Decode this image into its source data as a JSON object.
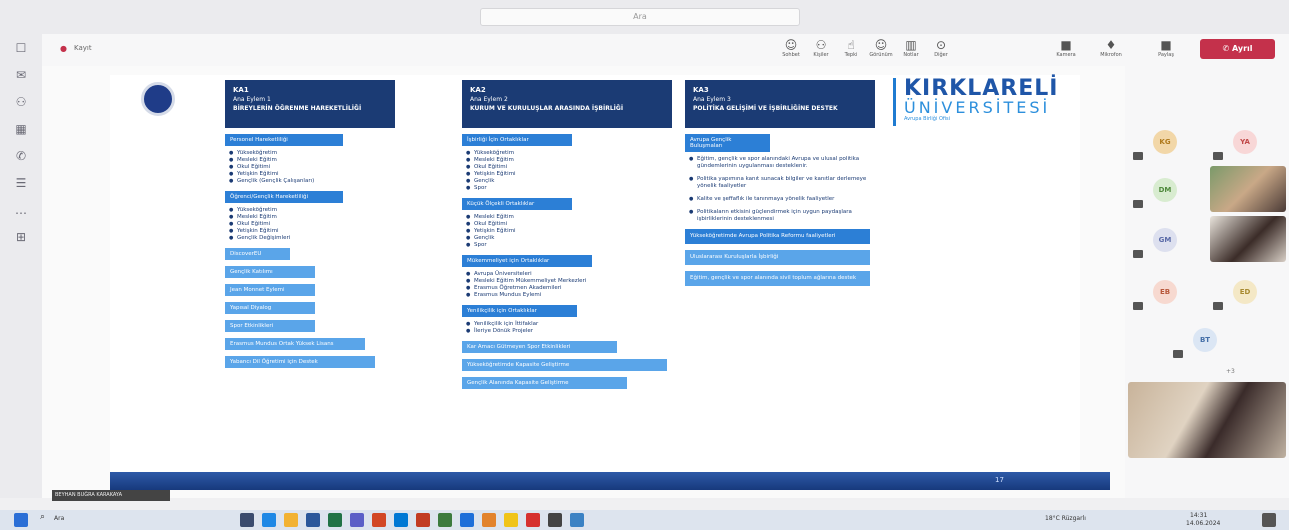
{
  "app": {
    "search_placeholder": "Ara"
  },
  "toolbar": {
    "items": [
      "Sohbet",
      "Kişiler",
      "Tepki",
      "Görünüm",
      "Notlar",
      "Diğer",
      "Kamera",
      "Mikrofon",
      "Paylaş"
    ],
    "leave_label": "Ayrıl"
  },
  "meeting": {
    "status": "Kayıt"
  },
  "slide": {
    "logo_title": "KIRKLARELİ",
    "logo_sub": "ÜNİVERSİTESİ",
    "logo_small": "Avrupa Birliği Ofisi",
    "col1": {
      "code": "KA1",
      "subtitle": "Ana Eylem 1",
      "title": "BİREYLERİN ÖĞRENME HAREKETLİLİĞİ",
      "sec1": "Personel Hareketliliği",
      "items1": [
        "Yükseköğretim",
        "Mesleki Eğitim",
        "Okul Eğitimi",
        "Yetişkin Eğitimi",
        "Gençlik (Gençlik Çalışanları)"
      ],
      "sec2": "Öğrenci/Gençlik Hareketliliği",
      "items2": [
        "Yükseköğretim",
        "Mesleki Eğitim",
        "Okul Eğitimi",
        "Yetişkin Eğitimi",
        "Gençlik Değişimleri"
      ],
      "boxes": [
        "DiscoverEU",
        "Gençlik Katılımı",
        "Jean Monnet Eylemi",
        "Yapısal Diyalog",
        "Spor Etkinlikleri",
        "Erasmus Mundus Ortak Yüksek Lisans",
        "Yabancı Dil Öğretimi için Destek"
      ]
    },
    "col2": {
      "code": "KA2",
      "subtitle": "Ana Eylem 2",
      "title": "KURUM VE KURULUŞLAR ARASINDA İŞBİRLİĞİ",
      "sec1": "İşbirliği İçin Ortaklıklar",
      "items1": [
        "Yükseköğretim",
        "Mesleki Eğitim",
        "Okul Eğitimi",
        "Yetişkin Eğitimi",
        "Gençlik",
        "Spor"
      ],
      "sec2": "Küçük Ölçekli Ortaklıklar",
      "items2": [
        "Mesleki Eğitim",
        "Okul Eğitimi",
        "Yetişkin Eğitimi",
        "Gençlik",
        "Spor"
      ],
      "sec3": "Mükemmeliyet için Ortaklıklar",
      "items3": [
        "Avrupa Üniversiteleri",
        "Mesleki Eğitim Mükemmeliyet Merkezleri",
        "Erasmus Öğretmen Akademileri",
        "Erasmus Mundus Eylemi"
      ],
      "sec4": "Yenilikçilik için Ortaklıklar",
      "items4": [
        "Yenilikçilik için İttifaklar",
        "İleriye Dönük Projeler"
      ],
      "boxes": [
        "Kar Amacı Gütmeyen Spor Etkinlikleri",
        "Yükseköğretimde Kapasite Geliştirme",
        "Gençlik Alanında Kapasite Geliştirme"
      ]
    },
    "col3": {
      "code": "KA3",
      "subtitle": "Ana Eylem 3",
      "title": "POLİTİKA GELİŞİMİ VE İŞBİRLİĞİNE DESTEK",
      "sec1": "Avrupa Gençlik Buluşmaları",
      "paras": [
        "Eğitim, gençlik ve spor alanındaki Avrupa ve ulusal politika gündemlerinin uygulanması desteklenir.",
        "Politika yapımına kanıt sunacak bilgiler ve kanıtlar derlemeye yönelik faaliyetler",
        "Kalite ve şeffaflık ile tanınmaya yönelik faaliyetler",
        "Politikaların etkisini güçlendirmek için uygun paydaşlara işbirliklerinin desteklenmesi"
      ],
      "boxes": [
        "Yükseköğretimde Avrupa Politika Reformu faaliyetleri",
        "Uluslararası Kuruluşlarla İşbirliği",
        "Eğitim, gençlik ve spor alanında sivil toplum ağlarına destek"
      ]
    },
    "slide_number": "17"
  },
  "participants": [
    {
      "initials": "KG",
      "color": "#f2d7a8",
      "text": "#b07a1c"
    },
    {
      "initials": "YA",
      "color": "#f8d7d7",
      "text": "#c04848"
    },
    {
      "initials": "DM",
      "color": "#d8ecd0",
      "text": "#4f8a3c"
    },
    {
      "initials": "GM",
      "color": "#dde0ef",
      "text": "#5a6aa8"
    },
    {
      "initials": "EB",
      "color": "#f7d9d0",
      "text": "#b8583c"
    },
    {
      "initials": "ED",
      "color": "#f4e8c6",
      "text": "#a88a30"
    },
    {
      "initials": "BT",
      "color": "#dbe6f4",
      "text": "#456fa8"
    }
  ],
  "participant_more": "+3",
  "presenter_name": "BEYHAN BUĞRA KARAKAYA",
  "taskbar": {
    "search": "Ara",
    "weather": "18°C Rüzgarlı",
    "time": "14:31",
    "date": "14.06.2024"
  }
}
